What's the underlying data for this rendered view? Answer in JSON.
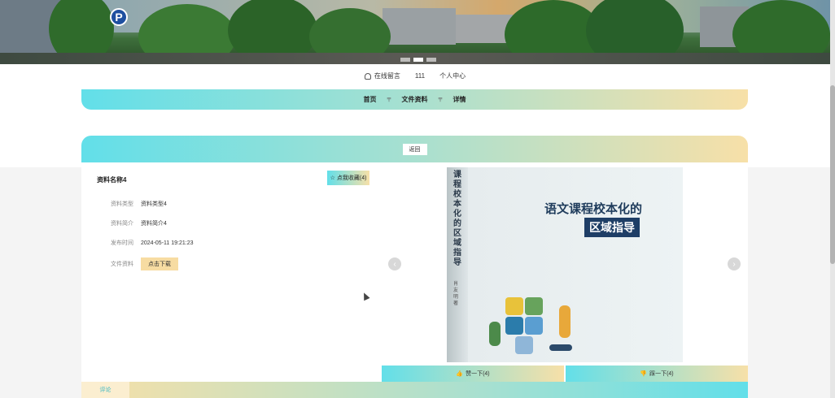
{
  "banner": {
    "parking_sign": "P",
    "slides": 3,
    "active_slide": 2
  },
  "userbar": {
    "consult": "在线留言",
    "username": "111",
    "profile": "个人中心"
  },
  "nav": {
    "home": "首页",
    "files": "文件资料",
    "detail": "详情",
    "separator": "〒"
  },
  "back_label": "返回",
  "detail": {
    "title": "资料名称4",
    "favorite_label": "点我收藏(4)",
    "fields": [
      {
        "label": "资料类型",
        "value": "资料类型4"
      },
      {
        "label": "资料简介",
        "value": "资料简介4"
      },
      {
        "label": "发布时间",
        "value": "2024-05-11 19:21:23"
      },
      {
        "label": "文件资料",
        "value": ""
      }
    ],
    "download_label": "点击下载"
  },
  "book": {
    "spine": "课程校本化的区域指导",
    "author_mark": "肖友明 著",
    "title": "语文课程校本化的",
    "subtitle": "区域指导"
  },
  "votes": {
    "like": "赞一下(4)",
    "dislike": "踩一下(4)"
  },
  "comment_tab": "评论",
  "colors": {
    "gradient_start": "#62dfe9",
    "gradient_end": "#f7e0a8",
    "download": "#f7dca2"
  }
}
